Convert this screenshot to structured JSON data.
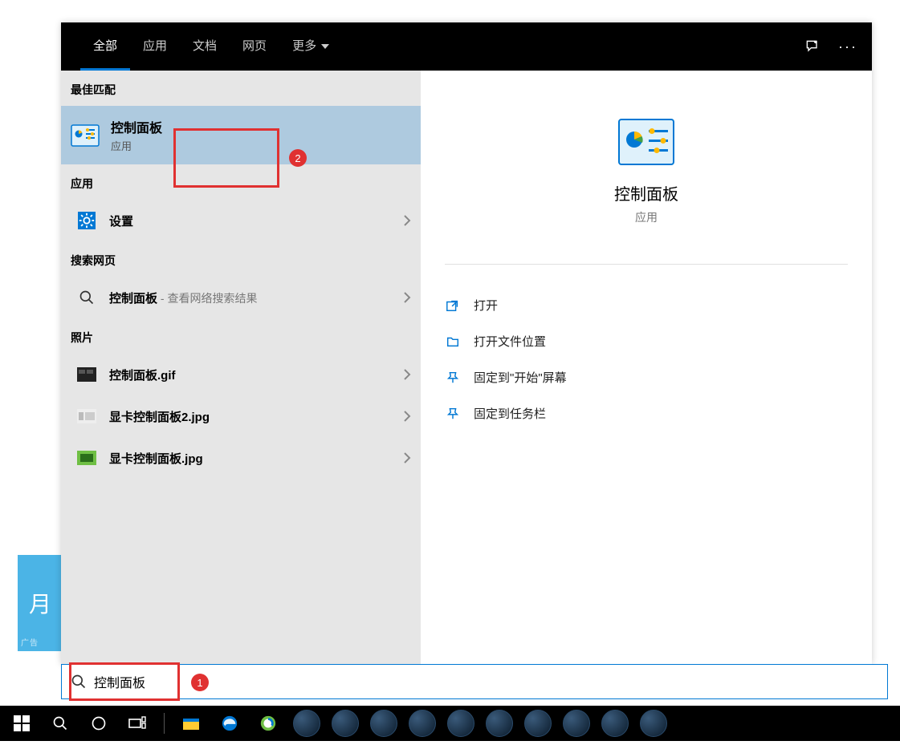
{
  "tabs": {
    "all": "全部",
    "apps": "应用",
    "docs": "文档",
    "web": "网页",
    "more": "更多"
  },
  "sections": {
    "best_match": "最佳匹配",
    "apps": "应用",
    "search_web": "搜索网页",
    "photos": "照片"
  },
  "best_match": {
    "title": "控制面板",
    "subtitle": "应用"
  },
  "apps_list": {
    "settings": "设置"
  },
  "web_list": {
    "cp_label": "控制面板",
    "cp_suffix": " - 查看网络搜索结果"
  },
  "photos_list": {
    "p1": "控制面板.gif",
    "p2": "显卡控制面板2.jpg",
    "p3": "显卡控制面板.jpg"
  },
  "right": {
    "title": "控制面板",
    "subtitle": "应用",
    "actions": {
      "open": "打开",
      "open_location": "打开文件位置",
      "pin_start": "固定到\"开始\"屏幕",
      "pin_taskbar": "固定到任务栏"
    }
  },
  "search": {
    "value": "控制面板"
  },
  "annotations": {
    "b1": "1",
    "b2": "2"
  },
  "ad": {
    "char": "月"
  }
}
